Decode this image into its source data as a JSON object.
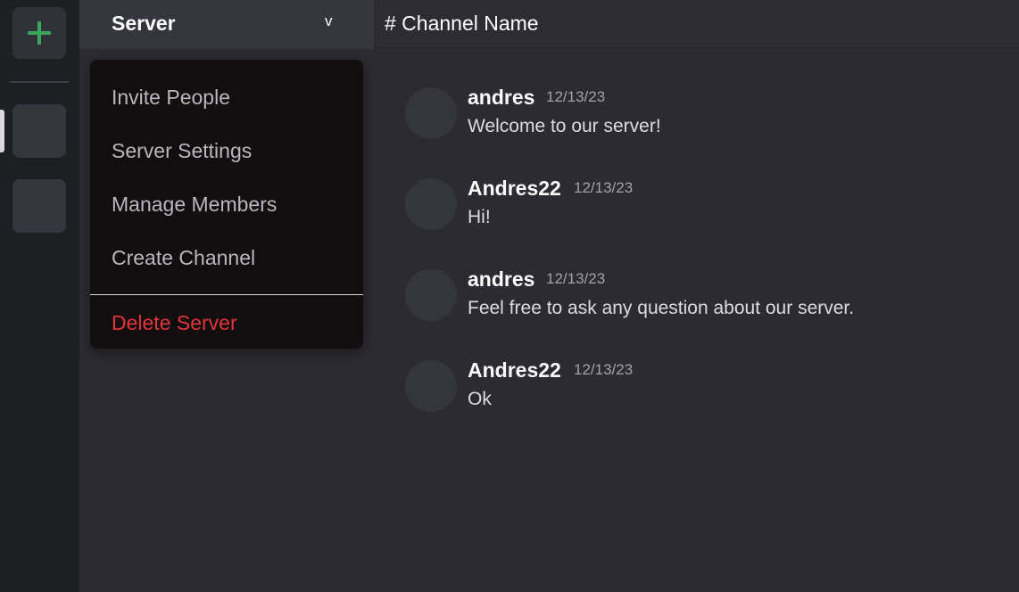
{
  "rail": {
    "add_icon": "plus-icon",
    "accent": "#3ba55d"
  },
  "sidebar": {
    "server_name": "Server",
    "chevron": "v"
  },
  "dropdown": {
    "items": [
      {
        "label": "Invite People"
      },
      {
        "label": "Server Settings"
      },
      {
        "label": "Manage Members"
      },
      {
        "label": "Create Channel"
      }
    ],
    "danger_item": {
      "label": "Delete Server",
      "color": "#e0353a"
    }
  },
  "main": {
    "channel_title": "# Channel Name",
    "messages": [
      {
        "author": "andres",
        "time": "12/13/23",
        "text": "Welcome to our server!"
      },
      {
        "author": "Andres22",
        "time": "12/13/23",
        "text": "Hi!"
      },
      {
        "author": "andres",
        "time": "12/13/23",
        "text": "Feel free to ask any question about our server."
      },
      {
        "author": "Andres22",
        "time": "12/13/23",
        "text": "Ok"
      }
    ]
  }
}
